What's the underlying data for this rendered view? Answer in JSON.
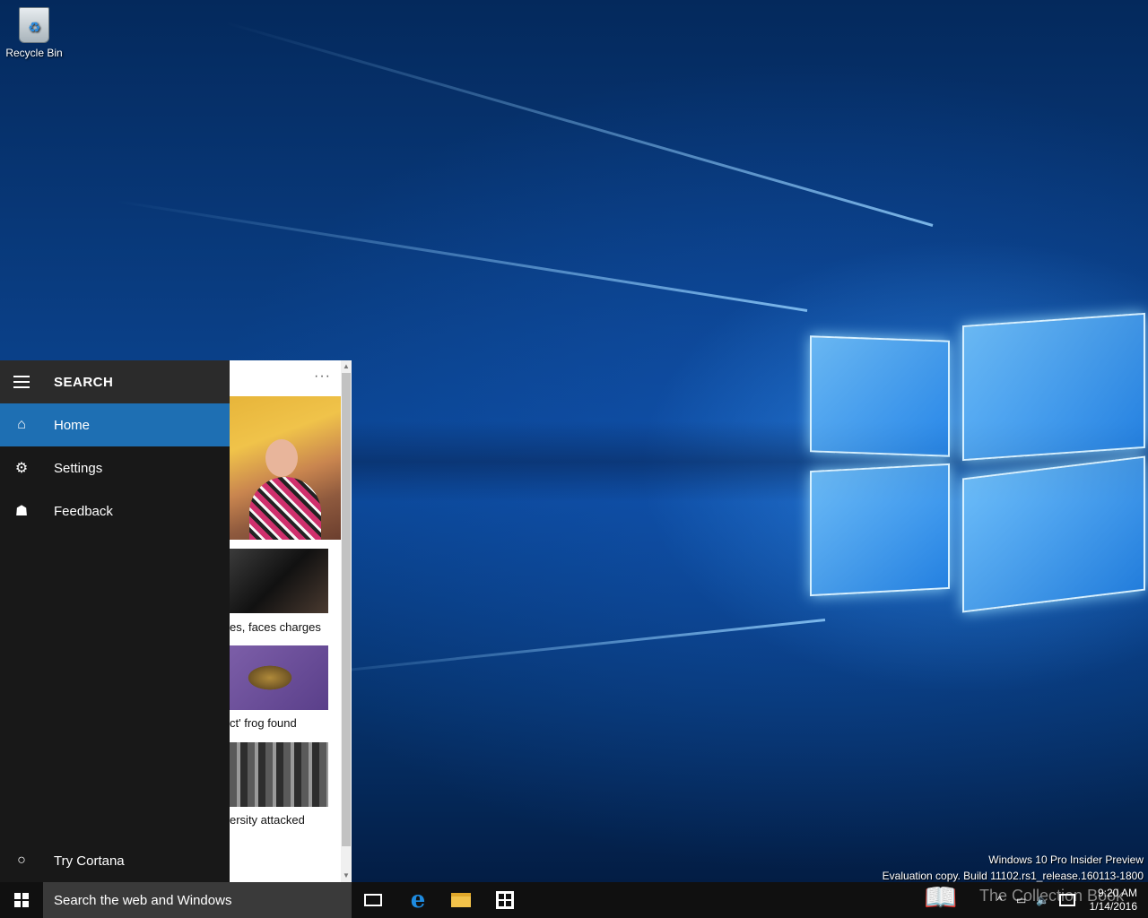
{
  "desktop": {
    "recycle_bin_label": "Recycle Bin",
    "watermark_line1": "Windows 10 Pro Insider Preview",
    "watermark_line2": "Evaluation copy. Build 11102.rs1_release.160113-1800"
  },
  "search_panel": {
    "title": "SEARCH",
    "nav_items": [
      {
        "label": "Home",
        "icon": "home-icon",
        "active": true
      },
      {
        "label": "Settings",
        "icon": "gear-icon",
        "active": false
      },
      {
        "label": "Feedback",
        "icon": "feedback-icon",
        "active": false
      }
    ],
    "try_cortana": "Try Cortana",
    "more_menu": "···",
    "news": [
      {
        "caption": "es, faces charges"
      },
      {
        "caption": "ct' frog found"
      },
      {
        "caption": "ersity attacked"
      }
    ]
  },
  "taskbar": {
    "search_placeholder": "Search the web and Windows",
    "time": "9:20 AM",
    "date": "1/14/2016",
    "tray_text": "The Collection Book"
  },
  "colors": {
    "accent": "#1e6fb3",
    "nav_bg": "#181818",
    "taskbar_bg": "#101010"
  }
}
